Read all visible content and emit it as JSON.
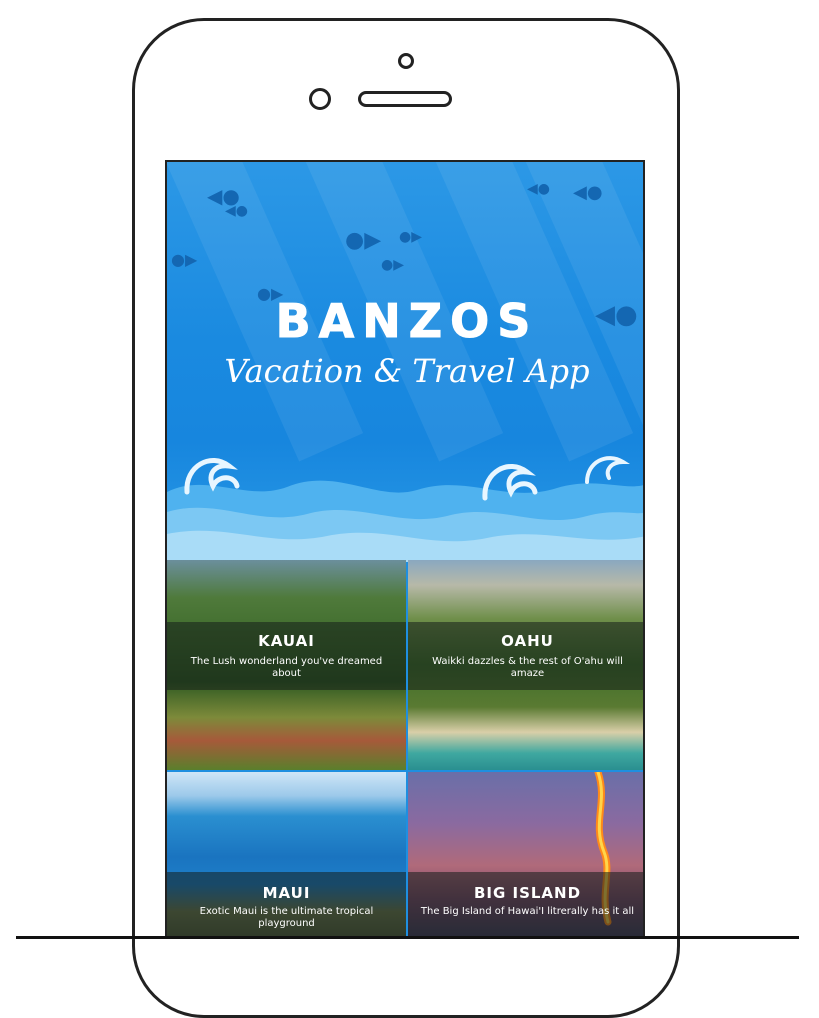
{
  "app": {
    "title": "BANZOS",
    "subtitle": "Vacation & Travel App"
  },
  "destinations": [
    {
      "name": "KAUAI",
      "description": "The Lush wonderland you've dreamed about"
    },
    {
      "name": "OAHU",
      "description": "Waikki dazzles & the rest of O'ahu will amaze"
    },
    {
      "name": "MAUI",
      "description": "Exotic Maui is the ultimate tropical playground"
    },
    {
      "name": "BIG ISLAND",
      "description": "The Big Island of Hawai'I litrerally has it all"
    }
  ],
  "colors": {
    "ocean": "#1a8ae0",
    "frame": "#222222"
  }
}
